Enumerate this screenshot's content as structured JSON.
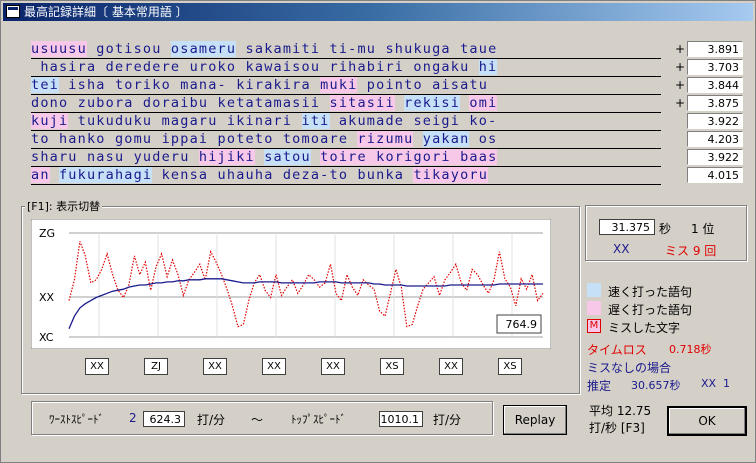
{
  "window": {
    "title": "最高記録詳細〔 基本常用語 〕"
  },
  "lines": [
    {
      "segs": [
        {
          "t": "usuusu",
          "c": "slow"
        },
        {
          "t": " gotisou "
        },
        {
          "t": "osameru",
          "c": "fast"
        },
        {
          "t": " sakamiti ti-mu shukuga taue"
        }
      ]
    },
    {
      "segs": [
        {
          "t": " hasira deredere uroko kawaisou rihabiri ongaku "
        },
        {
          "t": "hi",
          "c": "fast"
        }
      ]
    },
    {
      "segs": [
        {
          "t": "tei",
          "c": "fast"
        },
        {
          "t": " isha toriko mana- kirakira "
        },
        {
          "t": "muki",
          "c": "slow"
        },
        {
          "t": " pointo aisatu"
        }
      ]
    },
    {
      "segs": [
        {
          "t": "dono zubora doraibu ketatamasii "
        },
        {
          "t": "sitasii",
          "c": "slow"
        },
        {
          "t": " "
        },
        {
          "t": "rekisi",
          "c": "fast"
        },
        {
          "t": " "
        },
        {
          "t": "omi",
          "c": "slow"
        }
      ]
    },
    {
      "segs": [
        {
          "t": "kuji",
          "c": "slow"
        },
        {
          "t": " tukuduku magaru ikinari "
        },
        {
          "t": "iti",
          "c": "fast"
        },
        {
          "t": " akumade seigi ko-"
        }
      ]
    },
    {
      "segs": [
        {
          "t": "to hanko gomu ippai poteto tomoare "
        },
        {
          "t": "rizumu",
          "c": "slow"
        },
        {
          "t": " "
        },
        {
          "t": "yakan",
          "c": "fast"
        },
        {
          "t": " os"
        }
      ]
    },
    {
      "segs": [
        {
          "t": "sharu nasu yuderu "
        },
        {
          "t": "hijiki",
          "c": "slow"
        },
        {
          "t": " "
        },
        {
          "t": "satou",
          "c": "fast"
        },
        {
          "t": " "
        },
        {
          "t": "toire korigori baas",
          "c": "slow"
        }
      ]
    },
    {
      "segs": [
        {
          "t": "an",
          "c": "slow"
        },
        {
          "t": " "
        },
        {
          "t": "fukurahagi",
          "c": "fast"
        },
        {
          "t": " kensa uhauha deza-to bunka "
        },
        {
          "t": "tikayoru",
          "c": "slow"
        }
      ]
    }
  ],
  "scores": [
    {
      "mark": "+",
      "value": "3.891"
    },
    {
      "mark": "+",
      "value": "3.703"
    },
    {
      "mark": "+",
      "value": "3.844"
    },
    {
      "mark": "+",
      "value": "3.875"
    },
    {
      "mark": "",
      "value": "3.922"
    },
    {
      "mark": "",
      "value": "4.203"
    },
    {
      "mark": "",
      "value": "3.922"
    },
    {
      "mark": "",
      "value": "4.015"
    }
  ],
  "group_label": "[F1]: 表示切替",
  "chart_data": {
    "type": "line",
    "ylabels": [
      "ZG",
      "XX",
      "XC"
    ],
    "current_value_label": "764.9",
    "series": [
      {
        "color": "#e00000",
        "style": "dotted",
        "values": [
          0.35,
          0.55,
          0.92,
          0.78,
          0.52,
          0.55,
          0.65,
          0.8,
          0.6,
          0.45,
          0.38,
          0.5,
          0.78,
          0.6,
          0.72,
          0.45,
          0.68,
          0.8,
          0.58,
          0.74,
          0.6,
          0.4,
          0.55,
          0.62,
          0.7,
          0.55,
          0.82,
          0.72,
          0.6,
          0.46,
          0.3,
          0.1,
          0.12,
          0.35,
          0.52,
          0.6,
          0.45,
          0.38,
          0.6,
          0.4,
          0.48,
          0.55,
          0.42,
          0.5,
          0.6,
          0.55,
          0.48,
          0.52,
          0.7,
          0.42,
          0.35,
          0.6,
          0.48,
          0.4,
          0.55,
          0.5,
          0.46,
          0.25,
          0.2,
          0.42,
          0.65,
          0.48,
          0.1,
          0.12,
          0.3,
          0.46,
          0.52,
          0.58,
          0.4,
          0.55,
          0.62,
          0.7,
          0.52,
          0.45,
          0.65,
          0.6,
          0.5,
          0.42,
          0.55,
          0.82,
          0.56,
          0.48,
          0.3,
          0.56,
          0.46,
          0.6,
          0.35,
          0.42
        ]
      },
      {
        "color": "#1a1a8c",
        "style": "solid",
        "values": [
          0.08,
          0.2,
          0.28,
          0.32,
          0.35,
          0.38,
          0.4,
          0.42,
          0.44,
          0.45,
          0.46,
          0.48,
          0.49,
          0.5,
          0.5,
          0.51,
          0.52,
          0.52,
          0.53,
          0.53,
          0.54,
          0.54,
          0.55,
          0.55,
          0.55,
          0.56,
          0.56,
          0.56,
          0.56,
          0.55,
          0.54,
          0.53,
          0.52,
          0.52,
          0.52,
          0.53,
          0.53,
          0.53,
          0.53,
          0.52,
          0.52,
          0.52,
          0.52,
          0.52,
          0.52,
          0.52,
          0.53,
          0.53,
          0.53,
          0.53,
          0.52,
          0.52,
          0.52,
          0.52,
          0.52,
          0.52,
          0.51,
          0.51,
          0.5,
          0.5,
          0.5,
          0.5,
          0.49,
          0.49,
          0.49,
          0.49,
          0.49,
          0.49,
          0.49,
          0.49,
          0.5,
          0.5,
          0.5,
          0.5,
          0.5,
          0.5,
          0.5,
          0.5,
          0.5,
          0.51,
          0.51,
          0.51,
          0.51,
          0.51,
          0.51,
          0.51,
          0.51,
          0.51
        ]
      }
    ],
    "segment_ratings": [
      "XX",
      "ZJ",
      "XX",
      "XX",
      "XX",
      "XS",
      "XX",
      "XS"
    ]
  },
  "summary": {
    "time": "31.375",
    "time_unit": "秒",
    "rank": "1 位",
    "rank_grade": "XX",
    "miss": "ミス 9 回"
  },
  "legend": [
    {
      "label": "速く打った語句",
      "color": "#c6e0f8"
    },
    {
      "label": "遅く打った語句",
      "color": "#f8c8e8"
    },
    {
      "label": "ミスした文字",
      "color": "#e00000",
      "mark": "M"
    }
  ],
  "timeloss": {
    "label": "タイムロス",
    "value": "0.718秒"
  },
  "nomiss": {
    "label": "ミスなしの場合",
    "est_label": "推定",
    "est_value": "30.657秒",
    "est_grade": "XX",
    "est_rank": "1"
  },
  "speeds": {
    "worst_label": "ﾜｰｽﾄｽﾋﾟｰﾄﾞ",
    "worst_rank": "2",
    "worst_value": "624.3",
    "unit": "打/分",
    "tilde": "～",
    "top_label": "ﾄｯﾌﾟｽﾋﾟｰﾄﾞ",
    "top_value": "1010.1",
    "unit2": "打/分"
  },
  "average": {
    "line1": "平均 12.75",
    "line2": "打/秒 [F3]"
  },
  "buttons": {
    "replay": "Replay",
    "ok": "OK"
  }
}
